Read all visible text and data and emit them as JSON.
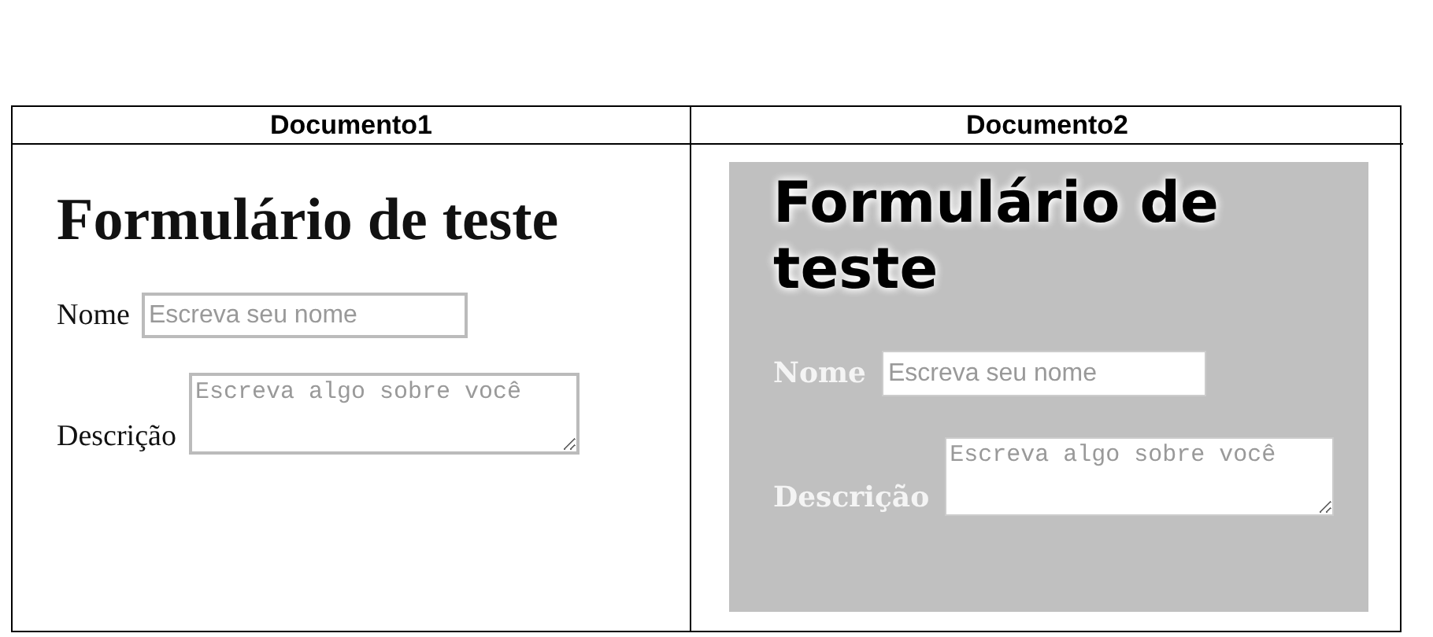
{
  "documents": [
    {
      "header": "Documento1",
      "kind": "plain",
      "heading": "Formulário de teste",
      "fields": [
        {
          "kind": "input",
          "label": "Nome",
          "placeholder": "Escreva seu nome"
        },
        {
          "kind": "textarea",
          "label": "Descrição",
          "placeholder": "Escreva algo sobre você"
        }
      ]
    },
    {
      "header": "Documento2",
      "kind": "styled",
      "heading": "Formulário de teste",
      "fields": [
        {
          "kind": "input",
          "label": "Nome",
          "placeholder": "Escreva seu nome"
        },
        {
          "kind": "textarea",
          "label": "Descrição",
          "placeholder": "Escreva algo sobre você"
        }
      ]
    }
  ]
}
